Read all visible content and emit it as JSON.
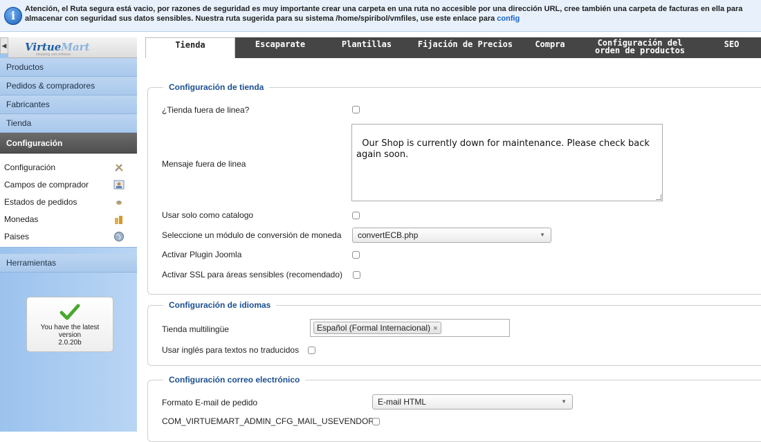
{
  "notice": {
    "icon": "info-icon",
    "text": "Atención, el Ruta segura está vacio, por razones de seguridad es muy importante crear una carpeta en una ruta no accesible por una dirección URL, cree también una carpeta de facturas en ella para almacenar con seguridad sus datos sensibles. Nuestra ruta sugerida para su sistema /home/spiribol/vmfiles, use este enlace para ",
    "link": "config"
  },
  "sidebar": {
    "logo_text": "Virtue",
    "logo_text_2": "Mart",
    "logo_sub": "shopping cart software",
    "collapse_glyph": "◀",
    "menu": [
      {
        "label": "Productos"
      },
      {
        "label": "Pedidos & compradores"
      },
      {
        "label": "Fabricantes"
      },
      {
        "label": "Tienda"
      },
      {
        "label": "Configuración"
      }
    ],
    "submenu": [
      {
        "label": "Configuración",
        "icon": "tools-icon"
      },
      {
        "label": "Campos de comprador",
        "icon": "user-form-icon"
      },
      {
        "label": "Estados de pedidos",
        "icon": "order-status-icon"
      },
      {
        "label": "Monedas",
        "icon": "coins-icon"
      },
      {
        "label": "Paises",
        "icon": "globe-icon"
      }
    ],
    "tools": "Herramientas",
    "version": {
      "line1": "You have the latest",
      "line2": "version",
      "line3": "2.0.20b"
    }
  },
  "tabs": [
    {
      "label": "Tienda",
      "active": true
    },
    {
      "label": "Escaparate"
    },
    {
      "label": "Plantillas"
    },
    {
      "label": "Fijación de Precios"
    },
    {
      "label": "Compra"
    },
    {
      "label": "Configuración del",
      "label2": "orden de productos"
    },
    {
      "label": "SEO"
    }
  ],
  "shop_config": {
    "legend": "Configuración de tienda",
    "offline_label": "¿Tienda fuera de linea?",
    "offline_message_label": "Mensaje fuera de linea",
    "offline_message_value": "Our Shop is currently down for maintenance. Please check back again soon.",
    "catalog_label": "Usar solo como catalogo",
    "currency_module_label": "Seleccione un módulo de conversión de moneda",
    "currency_module_value": "convertECB.php",
    "joomla_plugin_label": "Activar Plugin Joomla",
    "ssl_label": "Activar SSL para áreas sensibles (recomendado)"
  },
  "language_config": {
    "legend": "Configuración de idiomas",
    "multilingual_label": "Tienda multilingüe",
    "selected_language": "Español (Formal Internacional)",
    "chip_remove": "×",
    "english_fallback_label": "Usar inglés para textos no traducidos"
  },
  "email_config": {
    "legend": "Configuración correo electrónico",
    "format_label": "Formato E-mail de pedido",
    "format_value": "E-mail HTML",
    "usevendor_label": "COM_VIRTUEMART_ADMIN_CFG_MAIL_USEVENDOR"
  },
  "colors": {
    "tab_bar": "#454545",
    "legend": "#1c4f8f",
    "sidebar": "#a9c8ec",
    "active_menu": "#555555",
    "link": "#1764c9"
  }
}
